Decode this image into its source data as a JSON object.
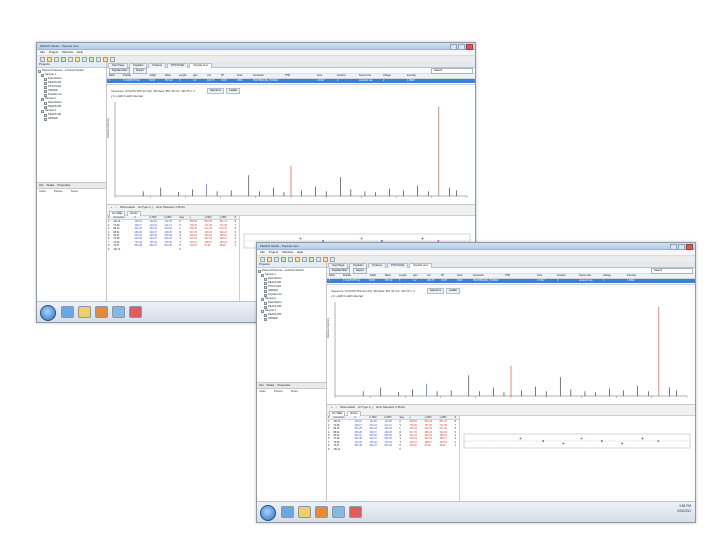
{
  "window": {
    "title": "PEAKS Studio - Peptide Ions",
    "menu": [
      "File",
      "Project",
      "Window",
      "Help"
    ]
  },
  "left_panel": {
    "header": "Projects",
    "tree": [
      "Plasma Proteome - enriched fraction",
      "Sample 1",
      "Data Refine",
      "PEAKS DB",
      "PTM Finder",
      "SPIDER",
      "Peptide Ions",
      "Sample 2",
      "Data Refine",
      "PEAKS DB",
      "Sample 3",
      "PEAKS DB",
      "SPIDER"
    ],
    "bottom_tabs": [
      "Info",
      "Peaks",
      "Properties"
    ],
    "props_header": [
      "Index",
      "Protein",
      "Score"
    ]
  },
  "main": {
    "doc_tabs": [
      "Start Page",
      "Peptides",
      "Proteins",
      "PTM Profile",
      "Peptide Ions"
    ],
    "filter_label": "Peptide Filter",
    "export_label": "Export",
    "search_placeholder": "Search",
    "grid_headers": [
      "Rank",
      "Peptide",
      "-10lgP",
      "Mass",
      "Length",
      "ppm",
      "m/z",
      "RT",
      "Scan",
      "Accession",
      "PTM",
      "Area",
      "Fraction",
      "Source File",
      "Charge",
      "Intensity"
    ],
    "grid_row": [
      "1",
      "K.VLDSVTPK.E",
      "54.63",
      "857.49",
      "8",
      "1.2",
      "429.75",
      "23.87",
      "1893",
      "P02768|ALBU_HUMAN",
      "",
      "2.37E7",
      "2",
      "sample1.raw",
      "2",
      "1.25E6"
    ],
    "spectrum": {
      "sequence_line": "Sequence: KVLDSVTPK  ALC(%): 98  Mass: 857.49  m/z: 429.75  z: 2",
      "legend": "  y  b  y-H2O  b-H2O  internal",
      "spec_tabs": [
        "Spectrum",
        "Ladder"
      ],
      "y_axis_label": "Relative Intensity"
    },
    "controls": {
      "show_label": "Show Labels",
      "ion_label": "Ion Type: b, y",
      "tolerance": "Error Tolerance: 0.05 Da"
    },
    "lower_tabs": [
      "Ion Table",
      "Errors"
    ],
    "frag_headers": [
      "#",
      "Immonium",
      "b",
      "b-H2O",
      "b-NH3",
      "Seq",
      "y",
      "y-H2O",
      "y-NH3",
      "#"
    ],
    "frag_rows": [
      [
        "1",
        "101.11",
        "129.10",
        "111.09",
        "112.08",
        "K",
        "858.50",
        "840.49",
        "841.47",
        "8"
      ],
      [
        "2",
        "72.08",
        "228.17",
        "210.16",
        "211.14",
        "V",
        "729.40",
        "711.39",
        "712.38",
        "7"
      ],
      [
        "3",
        "86.10",
        "341.25",
        "323.24",
        "324.23",
        "L",
        "630.34",
        "612.33",
        "613.31",
        "6"
      ],
      [
        "4",
        "88.04",
        "456.28",
        "438.27",
        "439.25",
        "D",
        "517.25",
        "499.24",
        "500.23",
        "5"
      ],
      [
        "5",
        "60.04",
        "543.31",
        "525.30",
        "526.29",
        "S",
        "402.23",
        "384.22",
        "385.20",
        "4"
      ],
      [
        "6",
        "72.08",
        "642.38",
        "624.37",
        "625.36",
        "V",
        "315.19",
        "297.18",
        "298.17",
        "3"
      ],
      [
        "7",
        "74.06",
        "743.43",
        "725.42",
        "726.40",
        "T",
        "216.12",
        "198.11",
        "199.10",
        "2"
      ],
      [
        "8",
        "70.07",
        "840.48",
        "822.47",
        "823.46",
        "P",
        "115.07",
        "97.06",
        "98.05",
        "1"
      ],
      [
        "9",
        "101.11",
        "",
        "",
        "",
        "K",
        "",
        "",
        "",
        ""
      ]
    ]
  },
  "taskbar": {
    "time": "3:58 PM",
    "date": "3/24/2011"
  },
  "colors": {
    "accent": "#3d7fd6",
    "peak": "#222222",
    "y_ion": "#d23a2e",
    "b_ion": "#2f56c6",
    "internal": "#c23fd6"
  }
}
